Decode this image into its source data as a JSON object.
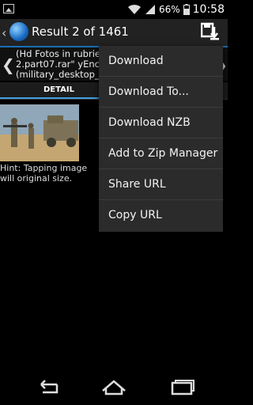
{
  "status_bar": {
    "battery_percent": "66%",
    "time": "10:58",
    "icons": [
      "image-icon",
      "wifi-icon",
      "signal-icon",
      "battery-icon"
    ]
  },
  "action_bar": {
    "title": "Result 2 of 1461",
    "icons": [
      "back-icon",
      "globe-icon",
      "save-download-icon"
    ]
  },
  "header": {
    "lines": [
      "(Hd Fotos in rubrieken",
      "2.part07.rar\" yEnc (0",
      "(military_desktop_29"
    ]
  },
  "tabs": {
    "detail": "DETAIL"
  },
  "content": {
    "hint": "Hint: Tapping image will original size."
  },
  "menu": {
    "items": [
      "Download",
      "Download To...",
      "Download NZB",
      "Add to Zip Manager",
      "Share URL",
      "Copy URL"
    ]
  },
  "nav_bar": {
    "icons": [
      "back-nav-icon",
      "home-nav-icon",
      "recent-apps-icon"
    ]
  },
  "colors": {
    "accent": "#1a6db5",
    "tab_indicator": "#3da1e6",
    "menu_bg": "#2b2b2b"
  }
}
